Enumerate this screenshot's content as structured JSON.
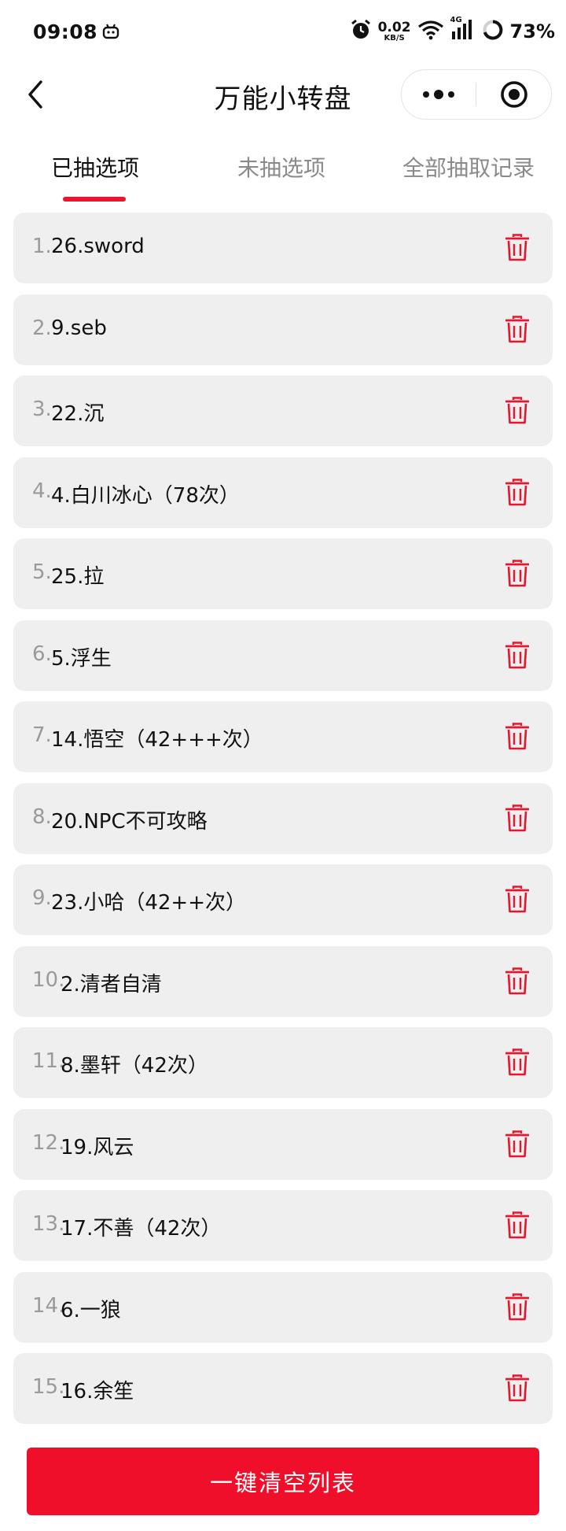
{
  "status_bar": {
    "time": "09:08",
    "net_speed_value": "0.02",
    "net_speed_unit": "KB/S",
    "network_type": "4G",
    "battery": "73%"
  },
  "header": {
    "title": "万能小转盘"
  },
  "tabs": [
    {
      "label": "已抽选项",
      "active": true
    },
    {
      "label": "未抽选项",
      "active": false
    },
    {
      "label": "全部抽取记录",
      "active": false
    }
  ],
  "items": [
    {
      "index": "1.",
      "label": "26.sword"
    },
    {
      "index": "2.",
      "label": "9.seb"
    },
    {
      "index": "3.",
      "label": "22.沉"
    },
    {
      "index": "4.",
      "label": "4.白川冰心（78次）"
    },
    {
      "index": "5.",
      "label": "25.拉"
    },
    {
      "index": "6.",
      "label": "5.浮生"
    },
    {
      "index": "7.",
      "label": "14.悟空（42+++次）"
    },
    {
      "index": "8.",
      "label": "20.NPC不可攻略"
    },
    {
      "index": "9.",
      "label": "23.小哈（42++次）"
    },
    {
      "index": "10.",
      "label": "2.清者自清"
    },
    {
      "index": "11.",
      "label": "8.墨轩（42次）"
    },
    {
      "index": "12.",
      "label": "19.风云"
    },
    {
      "index": "13.",
      "label": "17.不善（42次）"
    },
    {
      "index": "14.",
      "label": "6.一狼"
    },
    {
      "index": "15.",
      "label": "16.余笙"
    }
  ],
  "clear_button": {
    "label": "一键清空列表"
  },
  "colors": {
    "accent": "#e8152c",
    "button": "#ef0f2a",
    "row_bg": "#efefef"
  }
}
